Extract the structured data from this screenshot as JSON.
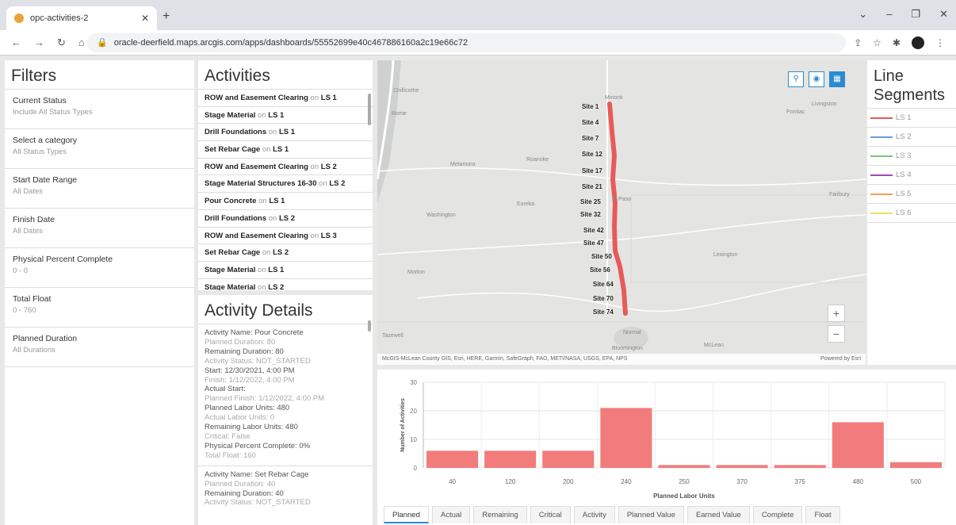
{
  "browser": {
    "tab_title": "opc-activities-2",
    "url": "oracle-deerfield.maps.arcgis.com/apps/dashboards/55552699e40c467886160a2c19e66c72"
  },
  "filters": {
    "title": "Filters",
    "items": [
      {
        "label": "Current Status",
        "value": "Include All Status Types"
      },
      {
        "label": "Select a category",
        "value": "All Status Types"
      },
      {
        "label": "Start Date Range",
        "value": "All Dates"
      },
      {
        "label": "Finish Date",
        "value": "All Dates"
      },
      {
        "label": "Physical Percent Complete",
        "value": "0 - 0"
      },
      {
        "label": "Total Float",
        "value": "0 - 760"
      },
      {
        "label": "Planned Duration",
        "value": "All Durations"
      }
    ]
  },
  "activities": {
    "title": "Activities",
    "connector": "on",
    "items": [
      {
        "name": "ROW and Easement Clearing",
        "seg": "LS 1"
      },
      {
        "name": "Stage Material",
        "seg": "LS 1"
      },
      {
        "name": "Drill Foundations",
        "seg": "LS 1"
      },
      {
        "name": "Set Rebar Cage",
        "seg": "LS 1"
      },
      {
        "name": "ROW and Easement Clearing",
        "seg": "LS 2"
      },
      {
        "name": "Stage Material Structures 16-30",
        "seg": "LS 2"
      },
      {
        "name": "Pour Concrete",
        "seg": "LS 1"
      },
      {
        "name": "Drill Foundations",
        "seg": "LS 2"
      },
      {
        "name": "ROW and Easement Clearing",
        "seg": "LS 3"
      },
      {
        "name": "Set Rebar Cage",
        "seg": "LS 2"
      },
      {
        "name": "Stage Material",
        "seg": "LS 1"
      },
      {
        "name": "Stage Material",
        "seg": "LS 2"
      }
    ]
  },
  "details": {
    "title": "Activity Details",
    "block1": [
      "Activity Name: Pour Concrete",
      "Planned Duration: 80",
      "Remaining Duration: 80",
      "Activity Status: NOT_STARTED",
      "Start: 12/30/2021, 4:00 PM",
      "Finish: 1/12/2022, 4:00 PM",
      "Actual Start:",
      "Planned Finish: 1/12/2022, 4:00 PM",
      "Planned Labor Units: 480",
      "Actual Labor Units: 0",
      "Remaining Labor Units: 480",
      "Critical: False",
      "Physical Percent Complete: 0%",
      "Total Float: 160"
    ],
    "block2": [
      "Activity Name: Set Rebar Cage",
      "Planned Duration: 40",
      "Remaining Duration: 40",
      "Activity Status: NOT_STARTED"
    ]
  },
  "map": {
    "places": [
      "Chillicothe",
      "Minonk",
      "Rome",
      "Pontiac",
      "Metamora",
      "Roanoke",
      "Washington",
      "Eureka",
      "El Paso",
      "Fairbury",
      "Lexington",
      "Morton",
      "Normal",
      "Bloomington",
      "Tazewell",
      "McLean",
      "Livingston"
    ],
    "sites": [
      "Site 1",
      "Site 4",
      "Site 7",
      "Site 12",
      "Site 17",
      "Site 21",
      "Site 25",
      "Site 32",
      "Site 42",
      "Site 47",
      "Site 50",
      "Site 56",
      "Site 64",
      "Site 70",
      "Site 74"
    ],
    "attribution": "McGIS-McLean County GIS, Esri, HERE, Garmin, SafeGraph, FAO, METI/NASA, USGS, EPA, NPS",
    "powered": "Powered by Esri",
    "zoom_in": "+",
    "zoom_out": "−"
  },
  "line_segments": {
    "title": "Line Segments",
    "items": [
      {
        "label": "LS 1",
        "color": "#e85a5a"
      },
      {
        "label": "LS 2",
        "color": "#6a9fd8"
      },
      {
        "label": "LS 3",
        "color": "#7cc47c"
      },
      {
        "label": "LS 4",
        "color": "#a04bb8"
      },
      {
        "label": "LS 5",
        "color": "#f0a050"
      },
      {
        "label": "LS 6",
        "color": "#f0e060"
      }
    ]
  },
  "chart_data": {
    "type": "bar",
    "categories": [
      "40",
      "120",
      "200",
      "240",
      "250",
      "370",
      "375",
      "480",
      "500"
    ],
    "values": [
      6,
      6,
      6,
      21,
      1,
      1,
      1,
      16,
      2
    ],
    "xlabel": "Planned Labor Units",
    "ylabel": "Number of Activities",
    "ylim": [
      0,
      30
    ],
    "yticks": [
      0,
      10,
      20,
      30
    ],
    "color": "#f27c7c",
    "grid": true
  },
  "bottom_tabs": [
    "Planned",
    "Actual",
    "Remaining",
    "Critical",
    "Activity",
    "Planned Value",
    "Earned Value",
    "Complete",
    "Float"
  ]
}
